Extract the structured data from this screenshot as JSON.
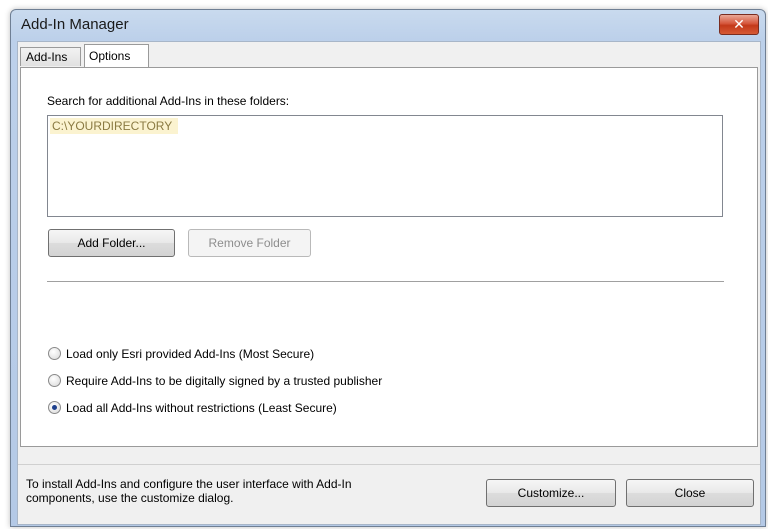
{
  "window": {
    "title": "Add-In Manager",
    "close_glyph": "✕"
  },
  "tabs": [
    {
      "label": "Add-Ins",
      "active": false
    },
    {
      "label": "Options",
      "active": true
    }
  ],
  "options": {
    "search_label": "Search for additional Add-Ins in these folders:",
    "folders": [
      "C:\\YOURDIRECTORY"
    ],
    "add_folder_label": "Add Folder...",
    "remove_folder_label": "Remove Folder",
    "radios": [
      {
        "label": "Load only Esri provided Add-Ins (Most Secure)",
        "checked": false
      },
      {
        "label": "Require Add-Ins to be digitally signed by a trusted publisher",
        "checked": false
      },
      {
        "label": "Load all Add-Ins without restrictions (Least Secure)",
        "checked": true
      }
    ]
  },
  "footer": {
    "hint_line1": "To install Add-Ins and configure the user interface with Add-In",
    "hint_line2": "components, use the customize dialog.",
    "customize_label": "Customize...",
    "close_label": "Close"
  },
  "colors": {
    "title_bar": "#c9daee",
    "close_button": "#c3391a",
    "folder_highlight": "#fbf3d0",
    "radio_checked": "#1d3f8c"
  }
}
